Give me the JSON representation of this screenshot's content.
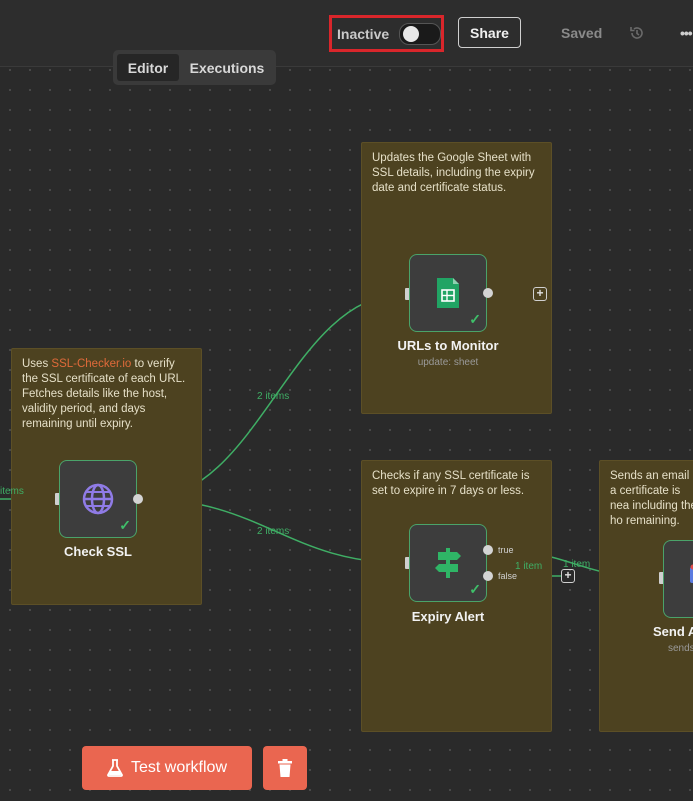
{
  "header": {
    "active_toggle_label": "Inactive",
    "share_label": "Share",
    "saved_label": "Saved",
    "more_label": "•••",
    "icons": {
      "history": "history-icon",
      "more": "more-icon"
    }
  },
  "tabs": [
    {
      "label": "Editor",
      "active": true
    },
    {
      "label": "Executions",
      "active": false
    }
  ],
  "stickies": {
    "sheet": "Updates the Google Sheet with SSL details, including the expiry date and certificate status.",
    "ssl_prefix": "Uses ",
    "ssl_link": "SSL-Checker.io",
    "ssl_suffix": " to verify the SSL certificate of each URL. Fetches details like the host, validity period, and days remaining until expiry.",
    "expiry": "Checks if any SSL certificate is set to expire in 7 days or less.",
    "email": "Sends an email a certificate is nea including the ho remaining."
  },
  "nodes": {
    "check_ssl": {
      "title": "Check SSL",
      "icon": "globe-icon"
    },
    "urls_to_monitor": {
      "title": "URLs to Monitor",
      "subtitle": "update: sheet",
      "icon": "google-sheets-icon"
    },
    "expiry_alert": {
      "title": "Expiry Alert",
      "icon": "signpost-icon",
      "true_label": "true",
      "false_label": "false"
    },
    "send_alert": {
      "title": "Send A",
      "subtitle": "sends"
    }
  },
  "edge_labels": {
    "incoming": "items",
    "to_sheet": "2 items",
    "to_expiry": "2 items",
    "true_to_email": "1 item",
    "false_branch": "1 item"
  },
  "footer": {
    "test_label": "Test workflow",
    "icons": {
      "test": "flask-icon",
      "delete": "trash-icon"
    }
  },
  "colors": {
    "accent": "#ea6650",
    "edge": "#3fae65",
    "sticky": "#4d4220",
    "highlight": "#d9262b"
  }
}
